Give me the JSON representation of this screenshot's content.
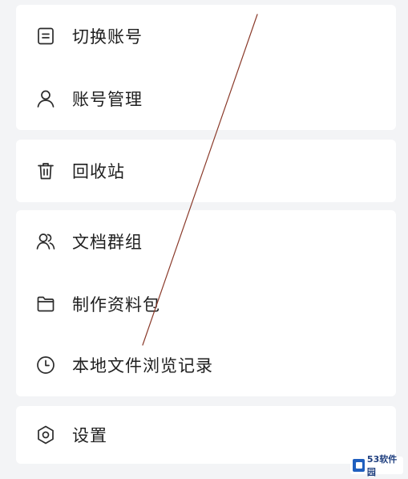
{
  "menu": {
    "switch_account": "切换账号",
    "account_manage": "账号管理",
    "recycle_bin": "回收站",
    "doc_groups": "文档群组",
    "make_package": "制作资料包",
    "local_history": "本地文件浏览记录",
    "settings": "设置"
  },
  "watermark": {
    "text": "53软件园"
  },
  "colors": {
    "annotation_line": "#8a3a2a",
    "accent": "#1f5fbf"
  }
}
